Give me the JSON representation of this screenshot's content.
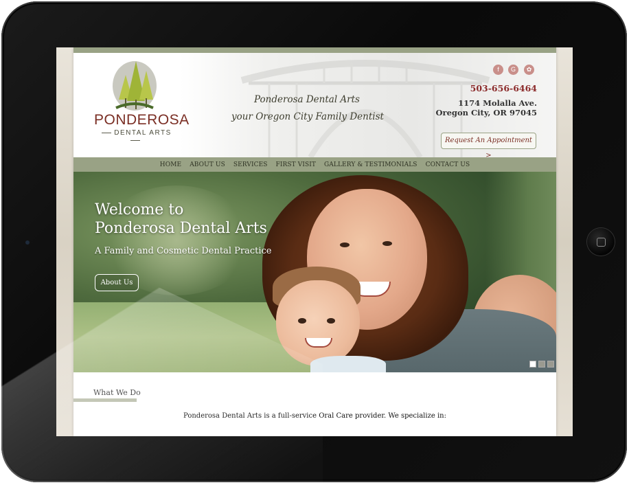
{
  "site": {
    "logo_name": "PONDEROSA",
    "logo_sub": "DENTAL ARTS",
    "tagline_1": "Ponderosa Dental Arts",
    "tagline_2": "your Oregon City Family Dentist"
  },
  "social": [
    {
      "icon": "facebook-icon",
      "glyph": "f"
    },
    {
      "icon": "google-icon",
      "glyph": "G"
    },
    {
      "icon": "yelp-icon",
      "glyph": "✿"
    }
  ],
  "contact": {
    "phone": "503-656-6464",
    "address_line1": "1174 Molalla Ave.",
    "address_line2": "Oregon City, OR 97045",
    "appointment_label": "Request An Appointment >"
  },
  "nav": {
    "items": [
      "HOME",
      "ABOUT US",
      "SERVICES",
      "FIRST VISIT",
      "GALLERY & TESTIMONIALS",
      "CONTACT US"
    ]
  },
  "hero": {
    "title_line1": "Welcome to",
    "title_line2": "Ponderosa Dental Arts",
    "subtitle": "A Family and Cosmetic Dental Practice",
    "button_label": "About Us",
    "slides": 3,
    "active_slide": 1
  },
  "content": {
    "section_title": "What We Do",
    "intro": "Ponderosa Dental Arts is a full-service Oral Care provider. We specialize in:"
  },
  "colors": {
    "accent_green": "#99a285",
    "brand_red": "#7a2e24",
    "phone_red": "#8b2a2a",
    "social_pink": "#c98f8a"
  }
}
